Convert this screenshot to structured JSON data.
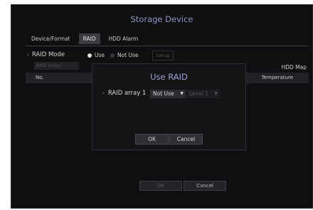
{
  "window": {
    "title": "Storage Device"
  },
  "tabs": [
    {
      "label": "Device/Format"
    },
    {
      "label": "RAID",
      "active": true
    },
    {
      "label": "HDD Alarm"
    }
  ],
  "raid_mode": {
    "label": "RAID Mode",
    "use_label": "Use",
    "not_use_label": "Not Use",
    "selected": "Use",
    "setup_label": "Setup",
    "array_select": "RAID array1"
  },
  "hdd_map_label": "HDD Map",
  "table": {
    "columns": [
      "No.",
      "N",
      "Temperature"
    ]
  },
  "bottom": {
    "ok_label": "OK",
    "cancel_label": "Cancel"
  },
  "modal": {
    "title": "Use RAID",
    "array_label": "RAID array 1",
    "mode_value": "Not Use",
    "level_value": "Level 1",
    "ok_label": "OK",
    "cancel_label": "Cancel"
  },
  "colors": {
    "accent": "#8f95c4",
    "background": "#0f0f11"
  }
}
